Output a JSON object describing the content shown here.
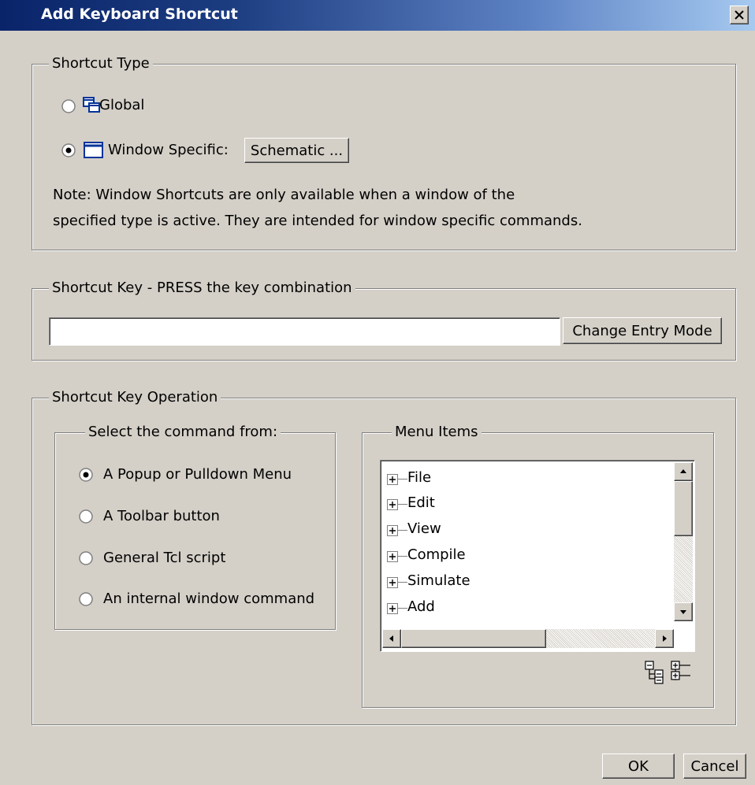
{
  "window": {
    "title": "Add Keyboard Shortcut",
    "close_label": "close"
  },
  "shortcut_type": {
    "legend": "Shortcut Type",
    "global_label": "Global",
    "window_specific_label": "Window Specific:",
    "window_type_button": "Schematic ...",
    "selected": "window_specific",
    "note_line1": "Note: Window Shortcuts are only available when a window of the",
    "note_line2": "specified type is active. They are intended for window specific commands."
  },
  "shortcut_key": {
    "legend": "Shortcut Key - PRESS the key combination",
    "value": "",
    "change_mode_button": "Change Entry Mode"
  },
  "operation": {
    "legend": "Shortcut Key Operation",
    "source": {
      "legend": "Select the command from:",
      "options": [
        {
          "label": "A Popup or Pulldown Menu",
          "selected": true
        },
        {
          "label": "A Toolbar button",
          "selected": false
        },
        {
          "label": "General Tcl script",
          "selected": false
        },
        {
          "label": "An internal window command",
          "selected": false
        }
      ]
    },
    "menu_items": {
      "legend": "Menu Items",
      "items": [
        "File",
        "Edit",
        "View",
        "Compile",
        "Simulate",
        "Add"
      ]
    }
  },
  "footer": {
    "ok_label": "OK",
    "cancel_label": "Cancel"
  },
  "icons": {
    "global": "windows-stack-icon",
    "window_specific": "window-icon",
    "expand_all": "expand-all-icon",
    "collapse_all": "collapse-all-icon"
  }
}
